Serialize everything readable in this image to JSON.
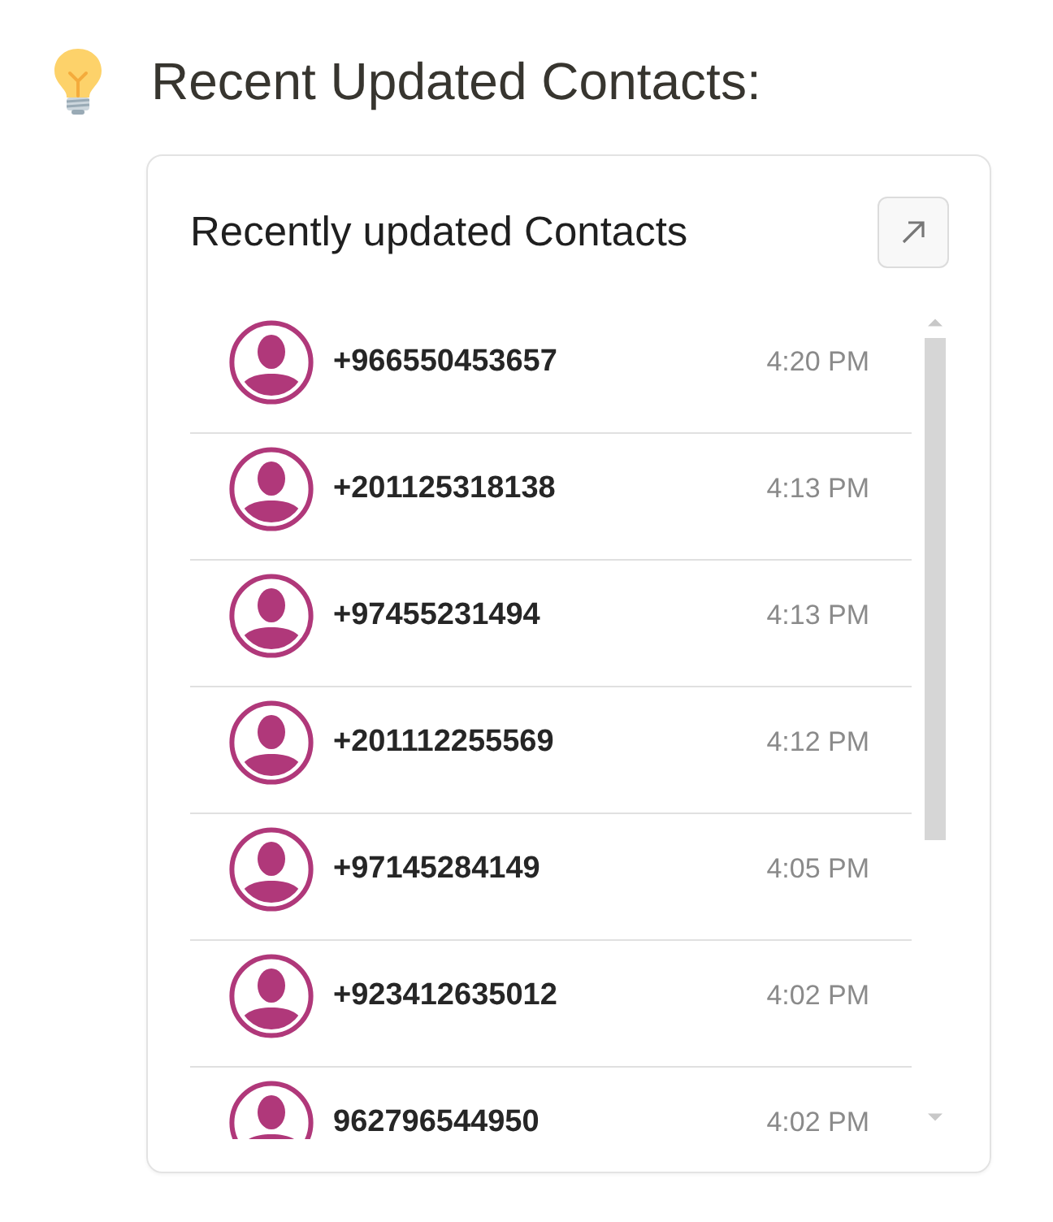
{
  "heading": {
    "title": "Recent Updated Contacts:"
  },
  "card": {
    "title": "Recently updated Contacts",
    "contacts": [
      {
        "phone": "+966550453657",
        "time": "4:20 PM"
      },
      {
        "phone": "+201125318138",
        "time": "4:13 PM"
      },
      {
        "phone": "+97455231494",
        "time": "4:13 PM"
      },
      {
        "phone": "+201112255569",
        "time": "4:12 PM"
      },
      {
        "phone": "+97145284149",
        "time": "4:05 PM"
      },
      {
        "phone": "+923412635012",
        "time": "4:02 PM"
      },
      {
        "phone": "962796544950",
        "time": "4:02 PM"
      }
    ]
  }
}
